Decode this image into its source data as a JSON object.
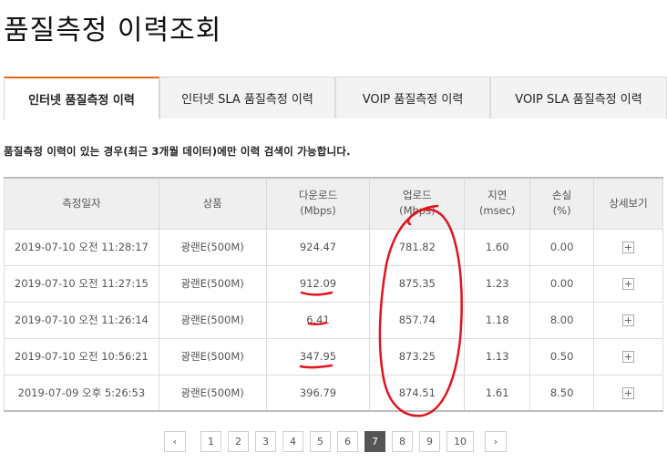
{
  "page": {
    "title": "품질측정 이력조회"
  },
  "tabs": [
    {
      "label": "인터넷 품질측정 이력",
      "active": true
    },
    {
      "label": "인터넷 SLA 품질측정 이력",
      "active": false
    },
    {
      "label": "VOIP 품질측정 이력",
      "active": false
    },
    {
      "label": "VOIP SLA 품질측정 이력",
      "active": false
    }
  ],
  "notice": "품질측정 이력이 있는 경우(최근 3개월 데이터)에만 이력 검색이 가능합니다.",
  "table": {
    "headers": {
      "date": "측정일자",
      "product": "상품",
      "download": "다운로드",
      "download_unit": "(Mbps)",
      "upload": "업로드",
      "upload_unit": "(Mbps)",
      "latency": "지연",
      "latency_unit": "(msec)",
      "loss": "손실",
      "loss_unit": "(%)",
      "detail": "상세보기"
    },
    "rows": [
      {
        "date": "2019-07-10 오전 11:28:17",
        "product": "광랜E(500M)",
        "download": "924.47",
        "upload": "781.82",
        "latency": "1.60",
        "loss": "0.00"
      },
      {
        "date": "2019-07-10 오전 11:27:15",
        "product": "광랜E(500M)",
        "download": "912.09",
        "upload": "875.35",
        "latency": "1.23",
        "loss": "0.00"
      },
      {
        "date": "2019-07-10 오전 11:26:14",
        "product": "광랜E(500M)",
        "download": "6.41",
        "upload": "857.74",
        "latency": "1.18",
        "loss": "8.00"
      },
      {
        "date": "2019-07-10 오전 10:56:21",
        "product": "광랜E(500M)",
        "download": "347.95",
        "upload": "873.25",
        "latency": "1.13",
        "loss": "0.50"
      },
      {
        "date": "2019-07-09 오후 5:26:53",
        "product": "광랜E(500M)",
        "download": "396.79",
        "upload": "874.51",
        "latency": "1.61",
        "loss": "8.50"
      }
    ]
  },
  "pagination": {
    "prev": "‹",
    "next": "›",
    "pages": [
      "1",
      "2",
      "3",
      "4",
      "5",
      "6",
      "7",
      "8",
      "9",
      "10"
    ],
    "current": "7"
  },
  "annotation_color": "#e0141e"
}
